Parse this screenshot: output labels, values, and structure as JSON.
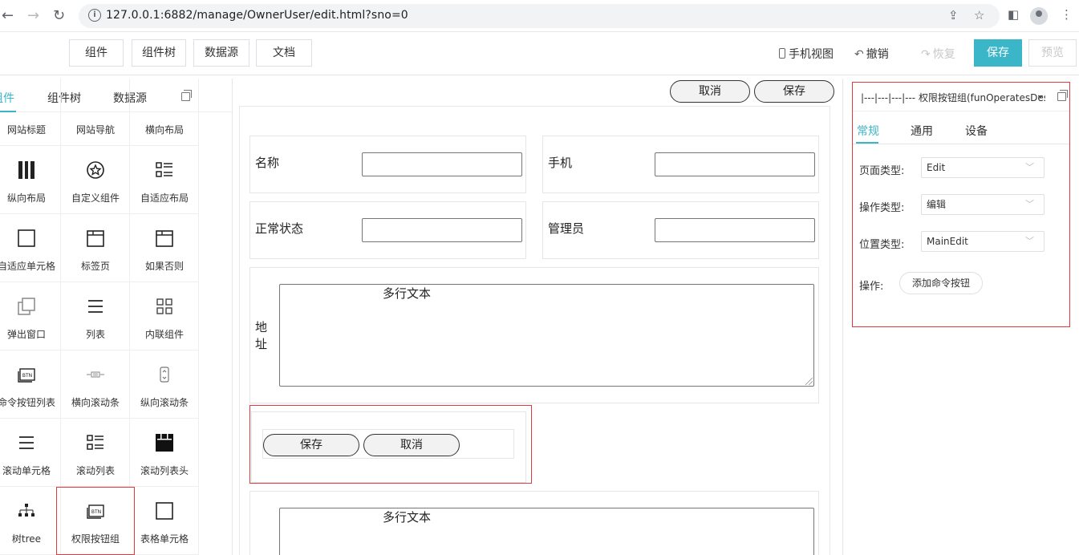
{
  "browser": {
    "url": "127.0.0.1:6882/manage/OwnerUser/edit.html?sno=0",
    "back_icon": "arrow-left-icon",
    "forward_icon": "arrow-right-icon",
    "reload_icon": "reload-icon"
  },
  "toolbar": {
    "buttons": [
      "组件",
      "组件树",
      "数据源",
      "文档"
    ],
    "mobile_view": "手机视图",
    "undo": "撤销",
    "redo": "恢复",
    "save": "保存",
    "preview": "预览",
    "accent_color": "#3bb5c8"
  },
  "left_panel": {
    "tabs": [
      "组件",
      "组件树",
      "数据源"
    ],
    "active_tab": "组件",
    "components": [
      {
        "label": "网站标题",
        "icon": ""
      },
      {
        "label": "网站导航",
        "icon": ""
      },
      {
        "label": "横向布局",
        "icon": ""
      },
      {
        "label": "纵向布局",
        "icon": "vertical-bars-icon"
      },
      {
        "label": "自定义组件",
        "icon": "star-circle-icon"
      },
      {
        "label": "自适应布局",
        "icon": "list-grid-icon"
      },
      {
        "label": "自适应单元格",
        "icon": "square-icon"
      },
      {
        "label": "标签页",
        "icon": "tab-window-icon"
      },
      {
        "label": "如果否则",
        "icon": "tab-window-icon"
      },
      {
        "label": "弹出窗口",
        "icon": "popup-window-icon"
      },
      {
        "label": "列表",
        "icon": "list-icon"
      },
      {
        "label": "内联组件",
        "icon": "four-squares-icon"
      },
      {
        "label": "命令按钮列表",
        "icon": "btn-icon"
      },
      {
        "label": "横向滚动条",
        "icon": "h-scrollbar-icon"
      },
      {
        "label": "纵向滚动条",
        "icon": "v-scrollbar-icon"
      },
      {
        "label": "滚动单元格",
        "icon": "list-icon"
      },
      {
        "label": "滚动列表",
        "icon": "list-grid-icon"
      },
      {
        "label": "滚动列表头",
        "icon": "table-header-icon"
      },
      {
        "label": "树tree",
        "icon": "tree-icon"
      },
      {
        "label": "权限按钮组",
        "icon": "btn-icon"
      },
      {
        "label": "表格单元格",
        "icon": "square-icon"
      }
    ],
    "selected_component": "权限按钮组"
  },
  "canvas": {
    "top_cancel": "取消",
    "top_save": "保存",
    "fields": [
      {
        "label": "名称",
        "value": ""
      },
      {
        "label": "手机",
        "value": ""
      },
      {
        "label": "正常状态",
        "value": ""
      },
      {
        "label": "管理员",
        "value": ""
      }
    ],
    "address_label": "地址",
    "textarea_placeholder": "多行文本",
    "group_save": "保存",
    "group_cancel": "取消",
    "textarea2_placeholder": "多行文本"
  },
  "right_panel": {
    "title": "|---|---|---|--- 权限按钮组(funOperatesDes",
    "tabs": [
      "常规",
      "通用",
      "设备"
    ],
    "active_tab": "常规",
    "page_type_label": "页面类型:",
    "page_type_value": "Edit",
    "op_type_label": "操作类型:",
    "op_type_value": "编辑",
    "pos_type_label": "位置类型:",
    "pos_type_value": "MainEdit",
    "op_label": "操作:",
    "add_cmd_button": "添加命令按钮"
  }
}
